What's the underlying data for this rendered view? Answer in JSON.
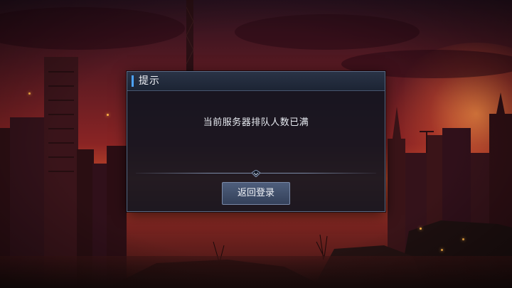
{
  "dialog": {
    "title": "提示",
    "message": "当前服务器排队人数已满",
    "button_label": "返回登录"
  },
  "colors": {
    "accent": "#4da3ff",
    "dialog_bg": "#0e1420",
    "button_bg": "#3e4b66"
  },
  "icons": {
    "divider": "diamond-chevron-icon"
  }
}
